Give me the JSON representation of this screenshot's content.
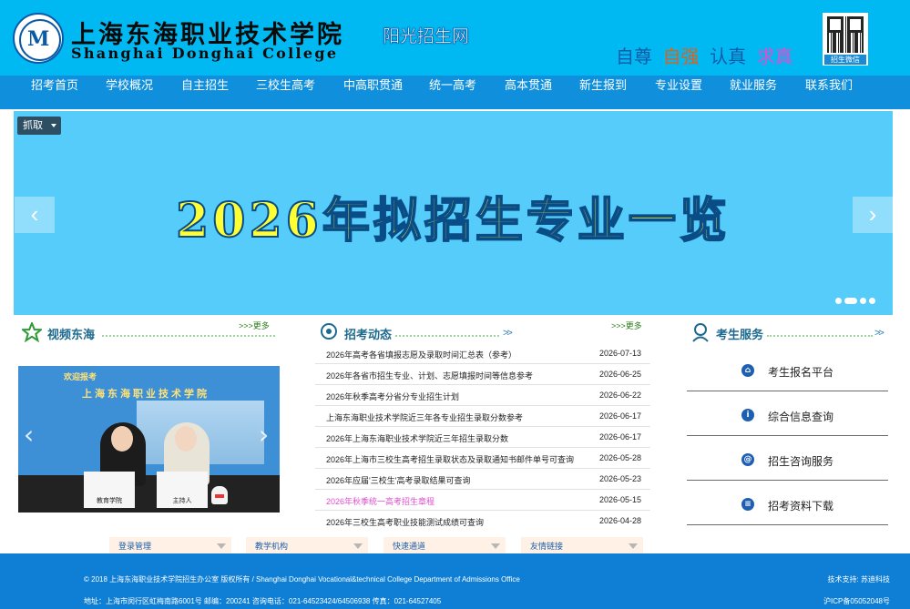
{
  "header": {
    "logo_cn": "上海东海职业技术学院",
    "logo_en": "Shanghai Donghai College",
    "sunshine": "阳光招生网",
    "mottos": [
      {
        "text": "自尊",
        "color": "#0a5aa8"
      },
      {
        "text": "自强",
        "color": "#e0601a"
      },
      {
        "text": "认真",
        "color": "#0a5aa8"
      },
      {
        "text": "求真",
        "color": "#e04ecf"
      }
    ],
    "qr_caption": "招生微信"
  },
  "nav": {
    "items": [
      "招考首页",
      "学校概况",
      "自主招生",
      "三校生高考",
      "中高职贯通",
      "统一高考",
      "高本贯通",
      "新生报到",
      "专业设置",
      "就业服务",
      "联系我们"
    ]
  },
  "banner": {
    "grab_label": "抓取",
    "title": "2026年拟招生专业一览",
    "prev_glyph": "‹",
    "next_glyph": "›"
  },
  "video_section": {
    "title": "视频东海",
    "more": ">>>更多",
    "bg_line1": "欢迎报考",
    "bg_line2": "上海东海职业技术学院",
    "sign_left": "教育学院",
    "sign_right": "主持人"
  },
  "news_section": {
    "title": "招考动态",
    "more": ">>>更多",
    "items": [
      {
        "title": "2026年高考各省填报志愿及录取时间汇总表（参考）",
        "date": "2026-07-13"
      },
      {
        "title": "2026年各省市招生专业、计划、志愿填报时间等信息参考",
        "date": "2026-06-25"
      },
      {
        "title": "2026年秋季高考分省分专业招生计划",
        "date": "2026-06-22"
      },
      {
        "title": "上海东海职业技术学院近三年各专业招生录取分数参考",
        "date": "2026-06-17"
      },
      {
        "title": "2026年上海东海职业技术学院近三年招生录取分数",
        "date": "2026-06-17"
      },
      {
        "title": "2026年上海市三校生高考招生录取状态及录取通知书邮件单号可查询",
        "date": "2026-05-28"
      },
      {
        "title": "2026年应届'三校生'高考录取结果可查询",
        "date": "2026-05-23"
      },
      {
        "title": "2026年秋季统一高考招生章程",
        "date": "2026-05-15"
      },
      {
        "title": "2026年三校生高考职业技能测试成绩可查询",
        "date": "2026-04-28"
      }
    ]
  },
  "service_section": {
    "title": "考生服务",
    "items": [
      {
        "label": "考生报名平台",
        "icon_glyph": "⌂"
      },
      {
        "label": "综合信息查询",
        "icon_glyph": "i"
      },
      {
        "label": "招生咨询服务",
        "icon_glyph": "@"
      },
      {
        "label": "招考资料下载",
        "icon_glyph": "≡"
      }
    ]
  },
  "link_bar": [
    "登录管理",
    "教学机构",
    "快速通道",
    "友情链接"
  ],
  "footer": {
    "copyright": "© 2018 上海东海职业技术学院招生办公室 版权所有 / Shanghai Donghai Vocational&technical College Department of Admissions Office",
    "address": "地址：上海市闵行区虹梅南路6001号 邮编：200241 咨询电话：021-64523424/64506938 传真：021-64527405",
    "tech": "技术支持: 苏迪科技",
    "icp": "沪ICP备05052048号"
  },
  "colors": {
    "header_bg": "#00b9f2",
    "nav_bg": "#0f8fdc",
    "banner_bg": "#56ccfa",
    "footer_bg": "#0f7fd6",
    "banner_text": "#ffff33"
  }
}
